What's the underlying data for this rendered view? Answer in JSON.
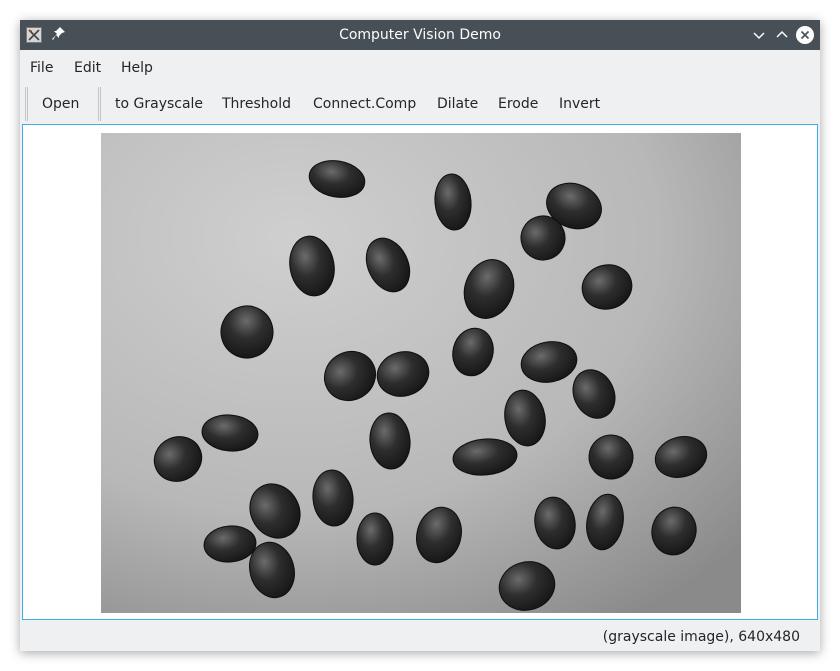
{
  "window": {
    "title": "Computer Vision Demo",
    "icons": [
      "app-icon",
      "pin-icon",
      "minimize-icon",
      "maximize-icon",
      "close-icon"
    ],
    "accent_color": "#3daee9",
    "titlebar_color": "#475057"
  },
  "menubar": {
    "items": [
      "File",
      "Edit",
      "Help"
    ]
  },
  "toolbar": {
    "open_label": "Open",
    "actions": [
      "to Grayscale",
      "Threshold",
      "Connect.Comp",
      "Dilate",
      "Erode",
      "Invert"
    ]
  },
  "status": {
    "text": "(grayscale image), 640x480"
  }
}
